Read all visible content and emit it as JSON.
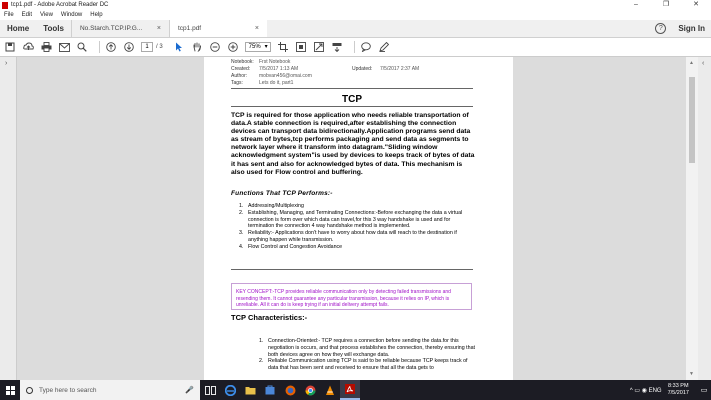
{
  "window": {
    "title": "tcp1.pdf - Adobe Acrobat Reader DC",
    "minimize": "–",
    "maximize": "❐",
    "close": "✕"
  },
  "menu": [
    "File",
    "Edit",
    "View",
    "Window",
    "Help"
  ],
  "tabs": {
    "home": "Home",
    "tools": "Tools",
    "doc1": "No.Starch.TCP.IP.G...",
    "doc2": "tcp1.pdf",
    "help": "?",
    "sign_in": "Sign In"
  },
  "toolbar": {
    "page_current": "1",
    "page_total": "/ 3",
    "zoom": "75%"
  },
  "document": {
    "meta": {
      "notebook_label": "Notebook:",
      "notebook_value": "Frst Notebook",
      "created_label": "Created:",
      "created_value": "7/5/2017 1:13 AM",
      "updated_label": "Updated:",
      "updated_value": "7/5/2017 2:37 AM",
      "author_label": "Author:",
      "author_value": "mobvan456@omai.com",
      "tags_label": "Tags:",
      "tags_value": "Lets do it, part1"
    },
    "title": "TCP",
    "intro": "TCP is required for those application who needs reliable transportation of data.A stable connection is required,after establishing the connection devices can transport data bidirectionally.Application programs send data as stream of bytes,tcp performs packaging and send data as segments to network layer where it transform into datagram.\"Sliding window acknowledgment system\"is used by devices to  keeps track of bytes of data it has sent and also for acknowledged bytes of data. This mechanism is also used for Flow control and buffering.",
    "functions_heading": "Functions That TCP Performs:-",
    "functions": [
      {
        "n": "1.",
        "t": "Addressing/Multiplexing"
      },
      {
        "n": "2.",
        "t": "Establishing, Managing, and Terminating Connections:-Before exchanging the data a virtual connection is form over which data can travel,for this 3 way handshake is used and for termination the connection 4 way handshake method is implemented."
      },
      {
        "n": "3.",
        "t": "Reliability:- Applications don't have to worry about how data will reach to the destination if anything happen while transmission."
      },
      {
        "n": "4.",
        "t": "Flow Control and Congestion Avoidance"
      }
    ],
    "key_concept": "KEY CONCEPT:-TCP provides reliable communication only by detecting failed transmissions and resending them. It cannot guarantee any particular transmission, because it relies on IP, which is unreliable. All it can do is keep trying if an initial delivery attempt fails.",
    "characteristics_heading": "TCP Characteristics:-",
    "characteristics": [
      {
        "n": "1.",
        "t": "Connection-Oriented:- TCP requires a connection before sending the data.for this negotiation is occurs, and that process establishes the connection, thereby ensuring that both devices agree on how they will exchange data."
      },
      {
        "n": "2.",
        "t": "Reliable Communication using TCP is said to be reliable because TCP keeps track of data that has been sent and received to ensure that all the data gets to"
      }
    ]
  },
  "taskbar": {
    "search_placeholder": "Type here to search",
    "time": "8:33 PM",
    "date": "7/5/2017",
    "tray_symbols": "^  ▭  ◉  ENG"
  }
}
